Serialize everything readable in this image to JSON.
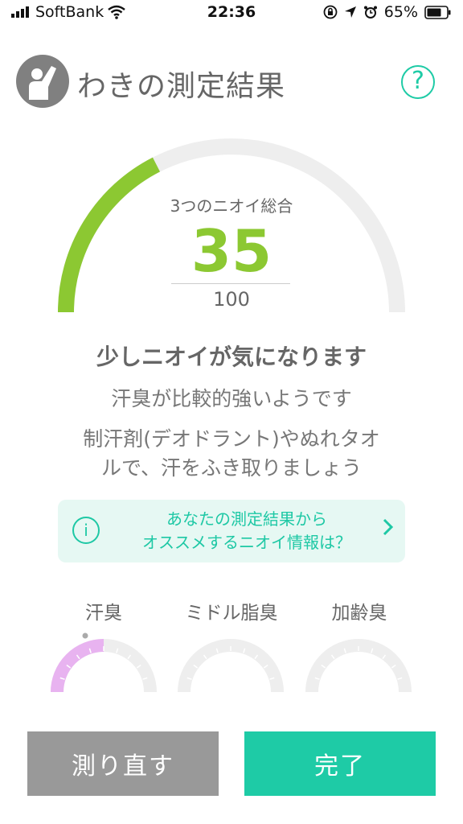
{
  "status_bar": {
    "carrier": "SoftBank",
    "time": "22:36",
    "battery": "65%"
  },
  "header": {
    "title": "わきの測定結果",
    "help_label": "?"
  },
  "gauge": {
    "label": "3つのニオイ総合",
    "score": "35",
    "max": "100",
    "value_fraction": 0.35,
    "fill_color": "#8cc832",
    "track_color": "#eeeeee"
  },
  "result": {
    "headline": "少しニオイが気になります",
    "subline": "汗臭が比較的強いようです",
    "advice_line1": "制汗剤(デオドラント)やぬれタオ",
    "advice_line2": "ルで、汗をふき取りましょう"
  },
  "info": {
    "line1": "あなたの測定結果から",
    "line2": "オススメするニオイ情報は？",
    "icon": "i"
  },
  "categories": [
    {
      "label": "汗臭",
      "level": 0.5,
      "color": "#e8b3f0"
    },
    {
      "label": "ミドル脂臭",
      "level": 0,
      "color": "#e8b3f0"
    },
    {
      "label": "加齢臭",
      "level": 0,
      "color": "#e8b3f0"
    }
  ],
  "buttons": {
    "remeasure": "測り直す",
    "done": "完了"
  },
  "colors": {
    "accent": "#1ecba6",
    "score_green": "#8cc832",
    "gray_button": "#999999"
  }
}
